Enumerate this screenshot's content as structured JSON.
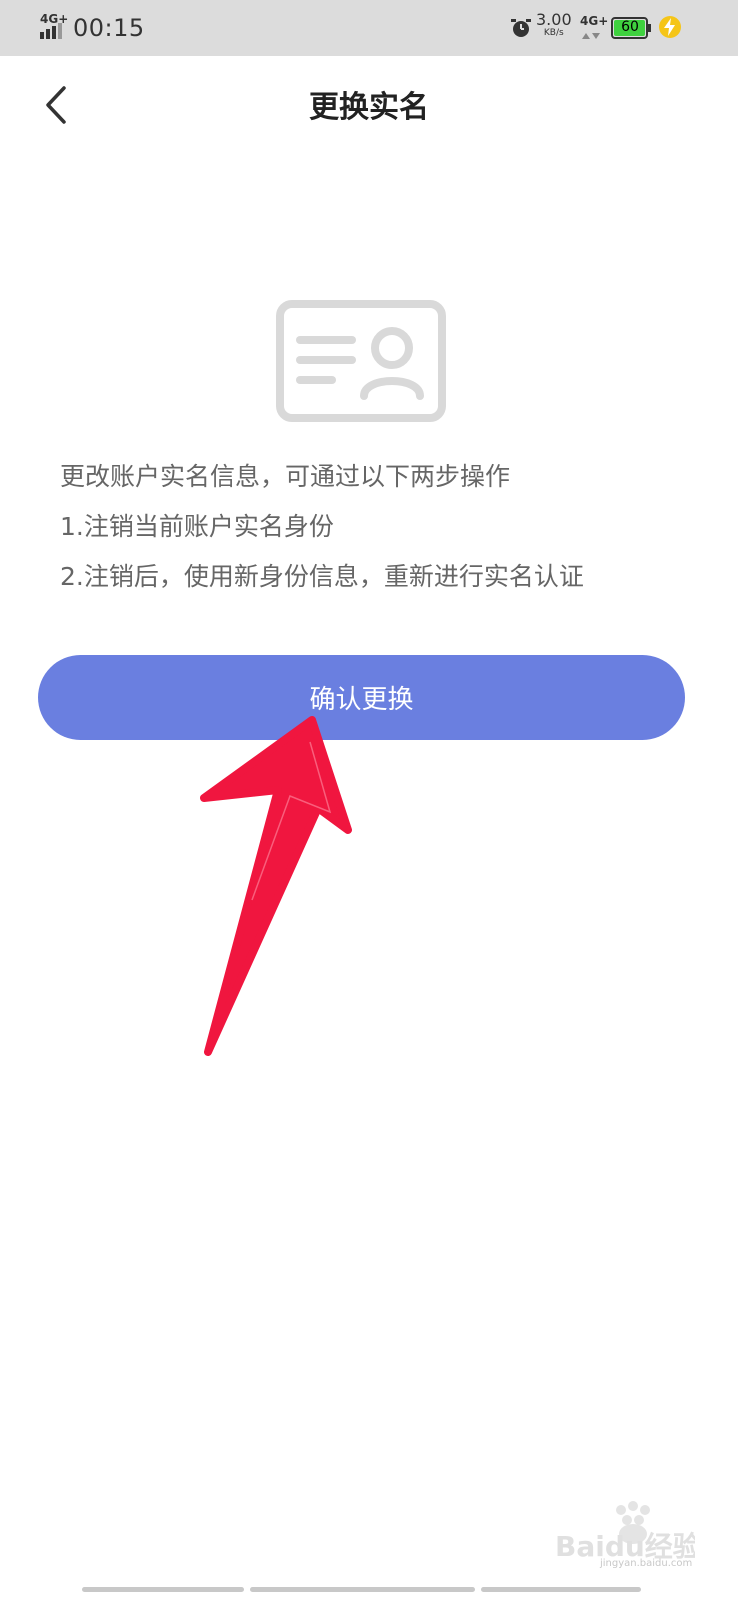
{
  "status_bar": {
    "network_left": "4G+",
    "time": "00:15",
    "speed_value": "3.00",
    "speed_unit": "KB/s",
    "network_right": "4G+",
    "battery_level": "60",
    "icons": [
      "signal-icon",
      "alarm-icon",
      "battery-icon",
      "charging-icon"
    ]
  },
  "header": {
    "title": "更换实名",
    "back_icon": "chevron-left-icon"
  },
  "illustration": {
    "icon": "id-card-icon",
    "color": "#d9d9d9"
  },
  "description": {
    "lines": [
      "更改账户实名信息，可通过以下两步操作",
      "1.注销当前账户实名身份",
      "2.注销后，使用新身份信息，重新进行实名认证"
    ]
  },
  "confirm_button": {
    "label": "确认更换",
    "color": "#6a7fe0"
  },
  "annotation": {
    "icon": "red-arrow",
    "color": "#f0163f"
  },
  "watermark": {
    "brand": "Baidu经验",
    "url": "jingyan.baidu.com"
  }
}
